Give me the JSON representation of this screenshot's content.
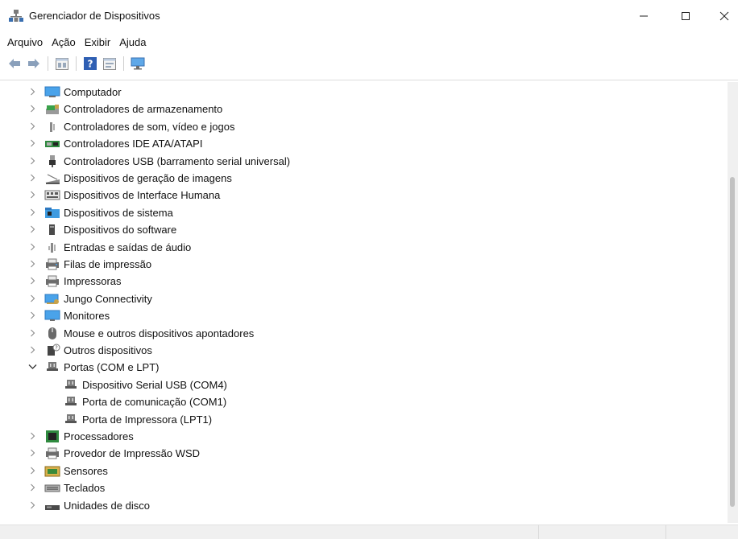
{
  "window": {
    "title": "Gerenciador de Dispositivos",
    "icon": "device-manager-icon"
  },
  "menu": [
    "Arquivo",
    "Ação",
    "Exibir",
    "Ajuda"
  ],
  "toolbar": [
    "back-icon",
    "forward-icon",
    "properties-icon",
    "help-icon",
    "driver-details-icon",
    "monitor-scan-icon"
  ],
  "tree": {
    "items": [
      {
        "label": "Computador",
        "icon": "computer-icon",
        "expanded": false
      },
      {
        "label": "Controladores de armazenamento",
        "icon": "storage-controller-icon",
        "expanded": false
      },
      {
        "label": "Controladores de som, vídeo e jogos",
        "icon": "speaker-icon",
        "expanded": false
      },
      {
        "label": "Controladores IDE ATA/ATAPI",
        "icon": "ide-controller-icon",
        "expanded": false
      },
      {
        "label": "Controladores USB (barramento serial universal)",
        "icon": "usb-icon",
        "expanded": false
      },
      {
        "label": "Dispositivos de geração de imagens",
        "icon": "scanner-icon",
        "expanded": false
      },
      {
        "label": "Dispositivos de Interface Humana",
        "icon": "hid-icon",
        "expanded": false
      },
      {
        "label": "Dispositivos de sistema",
        "icon": "system-folder-icon",
        "expanded": false
      },
      {
        "label": "Dispositivos do software",
        "icon": "software-device-icon",
        "expanded": false
      },
      {
        "label": "Entradas e saídas de áudio",
        "icon": "audio-io-icon",
        "expanded": false
      },
      {
        "label": "Filas de impressão",
        "icon": "print-queue-icon",
        "expanded": false
      },
      {
        "label": "Impressoras",
        "icon": "printer-icon",
        "expanded": false
      },
      {
        "label": "Jungo Connectivity",
        "icon": "jungo-icon",
        "expanded": false
      },
      {
        "label": "Monitores",
        "icon": "monitor-icon",
        "expanded": false
      },
      {
        "label": "Mouse e outros dispositivos apontadores",
        "icon": "mouse-icon",
        "expanded": false
      },
      {
        "label": "Outros dispositivos",
        "icon": "other-devices-icon",
        "expanded": false
      },
      {
        "label": "Portas (COM e LPT)",
        "icon": "port-icon",
        "expanded": true,
        "children": [
          {
            "label": "Dispositivo Serial USB (COM4)",
            "icon": "port-icon"
          },
          {
            "label": "Porta de comunicação (COM1)",
            "icon": "port-icon"
          },
          {
            "label": "Porta de Impressora (LPT1)",
            "icon": "port-icon"
          }
        ]
      },
      {
        "label": "Processadores",
        "icon": "processor-icon",
        "expanded": false
      },
      {
        "label": "Provedor de Impressão WSD",
        "icon": "wsd-printer-icon",
        "expanded": false
      },
      {
        "label": "Sensores",
        "icon": "sensor-icon",
        "expanded": false
      },
      {
        "label": "Teclados",
        "icon": "keyboard-icon",
        "expanded": false
      },
      {
        "label": "Unidades de disco",
        "icon": "disk-drive-icon",
        "expanded": false
      }
    ]
  }
}
